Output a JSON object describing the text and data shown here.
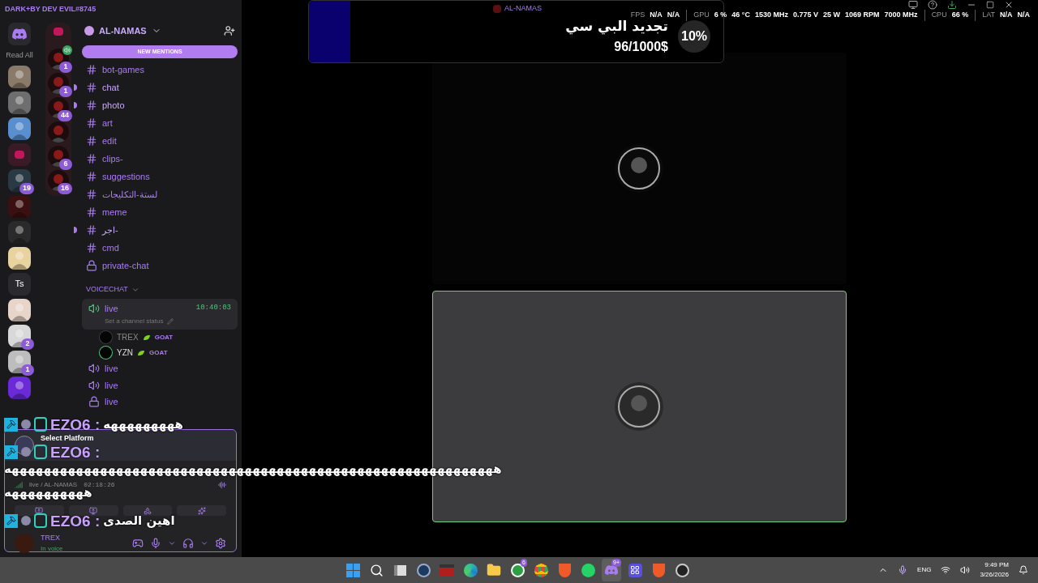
{
  "theme_label": "DARK+BY DEV EVIL#8745",
  "server_rail": {
    "read_all": "Read All",
    "servers": [
      {
        "kind": "picture",
        "color": "#8a7a6a"
      },
      {
        "kind": "picture",
        "color": "#6e6e6e"
      },
      {
        "kind": "picture",
        "color": "#5a8fcf"
      },
      {
        "kind": "folder",
        "color": "#c2185b"
      },
      {
        "kind": "picture",
        "color": "#2a3a44",
        "badge": "19"
      },
      {
        "kind": "picture",
        "color": "#3a1010"
      },
      {
        "kind": "picture",
        "color": "#2a2a2a"
      },
      {
        "kind": "picture",
        "color": "#e8d2a0"
      },
      {
        "kind": "text",
        "label": "Ts"
      },
      {
        "kind": "picture",
        "color": "#e6d5c8"
      },
      {
        "kind": "picture",
        "color": "#d8d8d8",
        "badge": "2"
      },
      {
        "kind": "picture",
        "color": "#bdbdbd",
        "badge": "1"
      },
      {
        "kind": "picture",
        "color": "#6a2ad8"
      }
    ]
  },
  "folder": {
    "items": [
      {
        "badge": "1",
        "speaking": true
      },
      {
        "badge": "1",
        "speaking": false
      },
      {
        "badge": "44",
        "speaking": false
      },
      {
        "speaking": false
      },
      {
        "badge": "6",
        "speaking": false
      },
      {
        "badge": "16",
        "speaking": false
      }
    ]
  },
  "server": {
    "name": "AL-NAMAS",
    "new_mentions": "NEW MENTIONS"
  },
  "channels": [
    {
      "kind": "text",
      "name": "bot-games",
      "unread": false
    },
    {
      "kind": "text",
      "name": "chat",
      "unread": true
    },
    {
      "kind": "text",
      "name": "photo",
      "unread": true
    },
    {
      "kind": "text",
      "name": "art",
      "unread": false
    },
    {
      "kind": "text",
      "name": "edit",
      "unread": false
    },
    {
      "kind": "text",
      "name": "clips-",
      "unread": false
    },
    {
      "kind": "text",
      "name": "suggestions",
      "unread": false
    },
    {
      "kind": "text",
      "name": "لستة-التكليجات",
      "unread": false
    },
    {
      "kind": "text",
      "name": "meme",
      "unread": false
    },
    {
      "kind": "text",
      "name": "اجر-",
      "unread": true
    },
    {
      "kind": "text",
      "name": "cmd",
      "unread": false
    },
    {
      "kind": "private",
      "name": "private-chat",
      "unread": false
    }
  ],
  "voice_category": "VOICECHAT",
  "voice_channels": [
    {
      "kind": "voice",
      "name": "live",
      "selected": true,
      "timer": "10:40:03",
      "status": "Set a channel status",
      "members": [
        {
          "name": "TREX",
          "tag": "GOAT",
          "speaking": false
        },
        {
          "name": "YZN",
          "tag": "GOAT",
          "speaking": true
        }
      ]
    },
    {
      "kind": "voice",
      "name": "live",
      "selected": false
    },
    {
      "kind": "voice",
      "name": "live",
      "selected": false
    },
    {
      "kind": "locked",
      "name": "live",
      "selected": false
    }
  ],
  "user_panel": {
    "activity": "Select Platform",
    "channel": "live / AL-NAMAS",
    "elapsed": "02:18:26",
    "username": "TREX",
    "status": "In voice"
  },
  "chat_overlay": [
    {
      "kind": "message",
      "author": "EZO6 :",
      "text": "هههههههههه"
    },
    {
      "kind": "message",
      "author": "EZO6 :"
    },
    {
      "kind": "wrap",
      "text": "هههههههههههههههههههههههههههههههههههههههههههههههههههههههههههههه"
    },
    {
      "kind": "wrap",
      "text": "ههههههههههه"
    },
    {
      "kind": "message",
      "author": "EZO6 :",
      "text": "اهين الصدى"
    }
  ],
  "goal_widget": {
    "title": "تجديد البي سي",
    "amount": "96/1000$",
    "percent": "10%",
    "level": 0.1
  },
  "window_title": "AL-NAMAS",
  "stats": [
    {
      "label": "FPS",
      "values": [
        "N/A",
        "N/A"
      ]
    },
    {
      "label": "GPU",
      "values": [
        "6 %",
        "46 °C",
        "1530 MHz",
        "0.775 V",
        "25 W",
        "1069 RPM",
        "7000 MHz"
      ]
    },
    {
      "label": "CPU",
      "values": [
        "66 %"
      ]
    },
    {
      "label": "LAT",
      "values": [
        "N/A",
        "N/A"
      ]
    }
  ],
  "tiles": [
    {
      "kind": "video",
      "speaking": false
    },
    {
      "kind": "video",
      "speaking": true
    }
  ],
  "taskbar": {
    "apps": [
      {
        "kind": "start"
      },
      {
        "kind": "search"
      },
      {
        "kind": "taskview"
      },
      {
        "kind": "steam"
      },
      {
        "kind": "voicemeeter"
      },
      {
        "kind": "edge"
      },
      {
        "kind": "files"
      },
      {
        "kind": "xbox",
        "badge": "6"
      },
      {
        "kind": "chrome"
      },
      {
        "kind": "brave"
      },
      {
        "kind": "whatsapp"
      },
      {
        "kind": "discord",
        "badge": "9+",
        "selected": true
      },
      {
        "kind": "grid"
      },
      {
        "kind": "brave"
      },
      {
        "kind": "obs"
      }
    ],
    "language": "ENG",
    "time": "9:49 PM",
    "date": "3/26/2026"
  }
}
